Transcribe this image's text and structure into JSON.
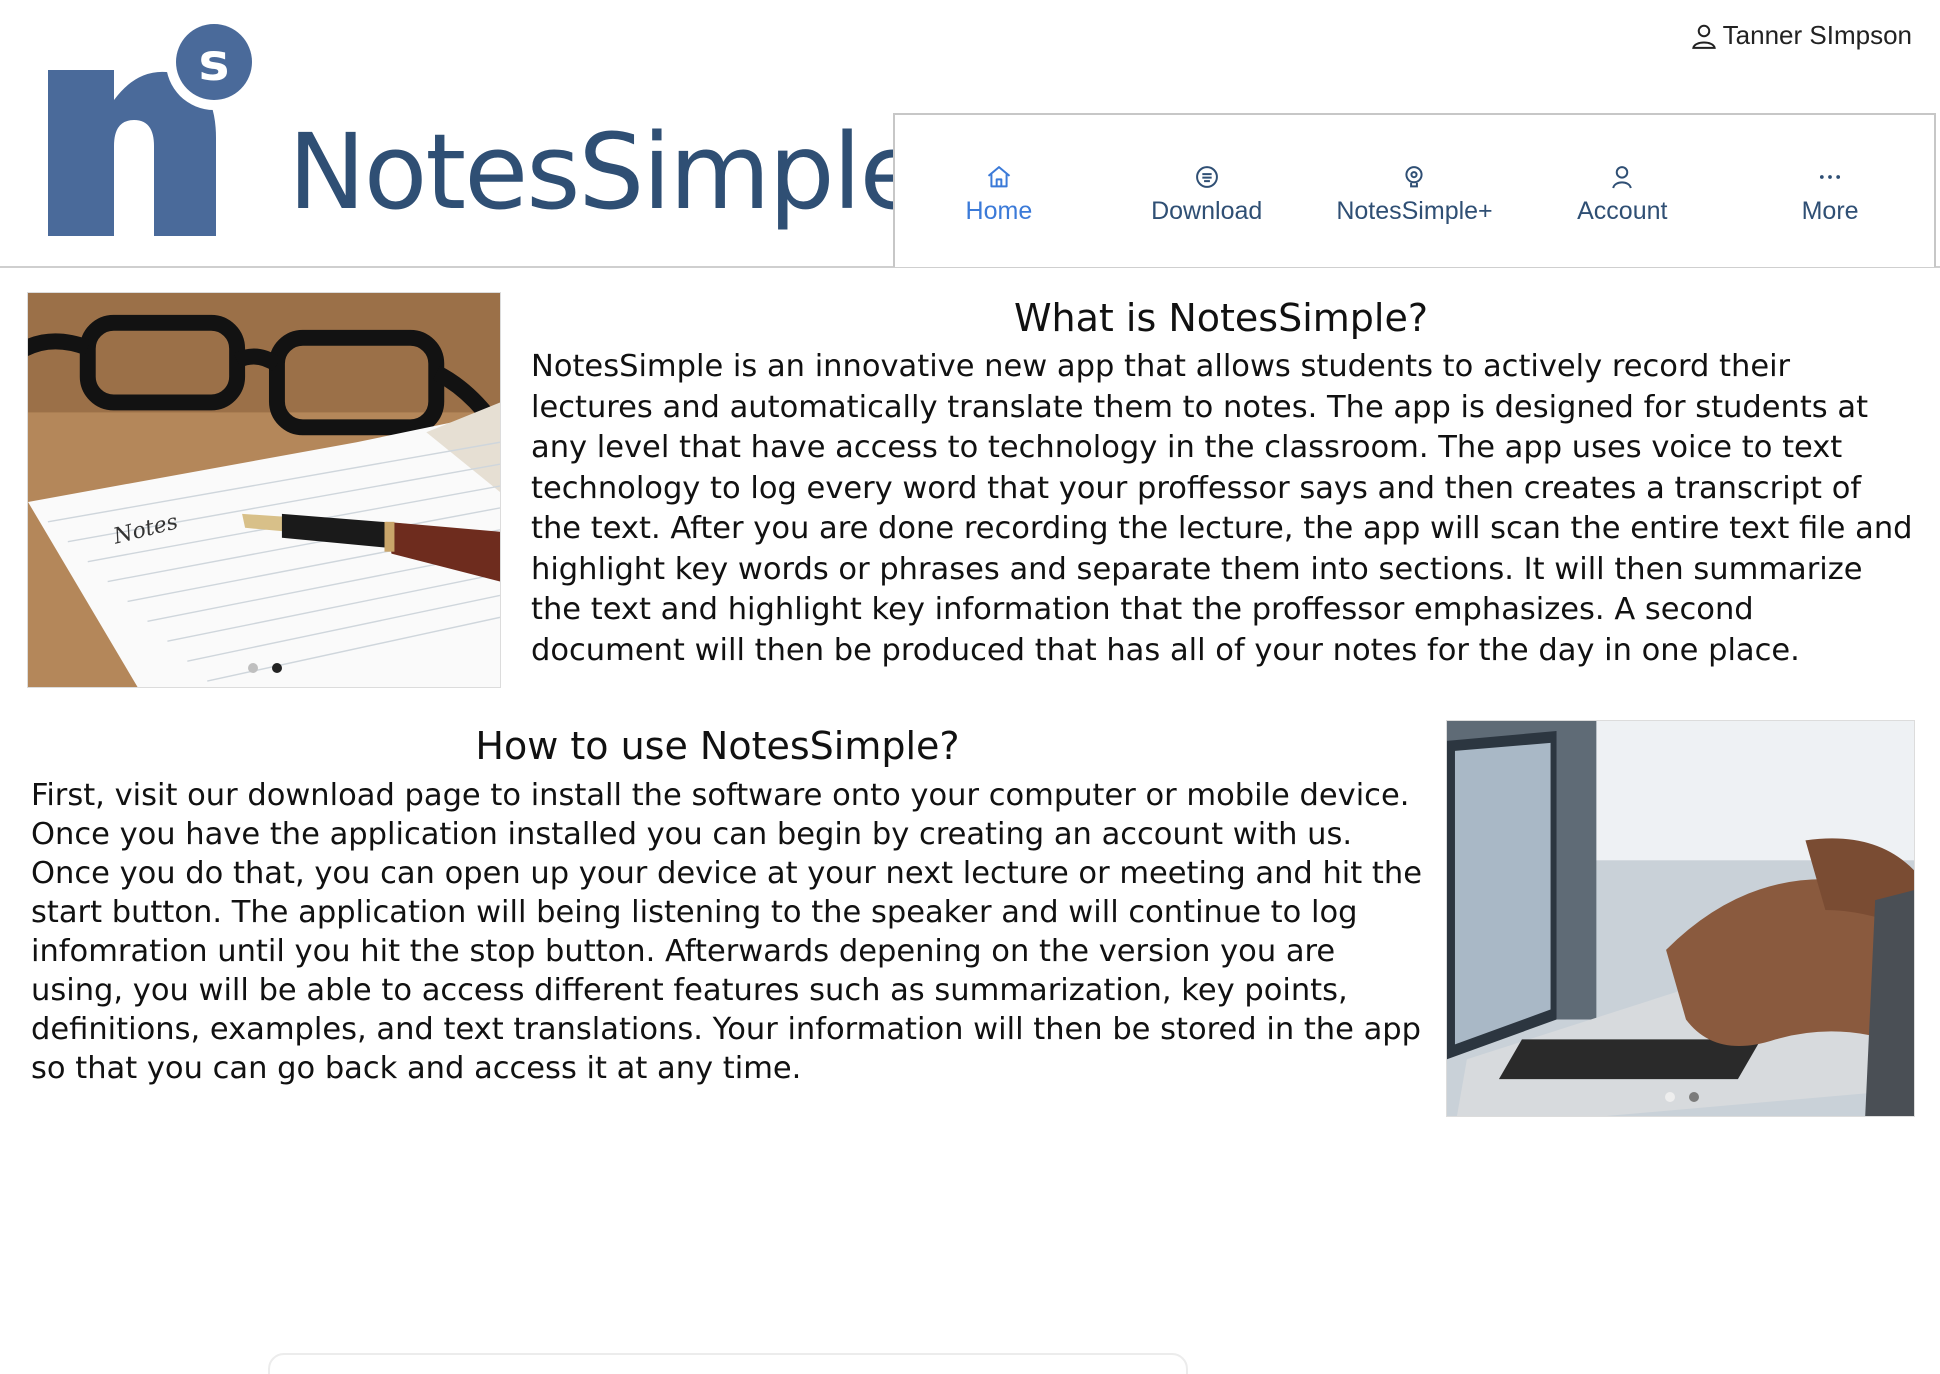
{
  "header": {
    "brand": "NotesSimple.",
    "logo_letters": {
      "main": "n",
      "badge": "s"
    },
    "user_name": "Tanner SImpson",
    "brand_color": "#2f4f74",
    "logo_color": "#4a6a9a"
  },
  "nav": {
    "items": [
      {
        "label": "Home",
        "icon": "home-icon",
        "active": true
      },
      {
        "label": "Download",
        "icon": "download-icon",
        "active": false
      },
      {
        "label": "NotesSimple+",
        "icon": "bulb-icon",
        "active": false
      },
      {
        "label": "Account",
        "icon": "person-icon",
        "active": false
      },
      {
        "label": "More",
        "icon": "ellipsis-icon",
        "active": false
      }
    ],
    "active_color": "#3b7ad8"
  },
  "section1": {
    "title": "What is NotesSimple?",
    "body": "NotesSimple is an innovative new app that allows students to actively record their lectures and automatically translate them to notes. The app is designed for students at any level that have access to technology in the classroom. The app uses voice to text technology to log every word that your proffessor says and then creates a transcript of the text. After you are done recording the lecture, the app will scan the entire text file and highlight key words or phrases and separate them into sections. It will then summarize the text and highlight key information that the proffessor emphasizes. A second document will then be produced that has all of your notes for the day in one place.",
    "image_label": "Notes",
    "carousel": {
      "count": 2,
      "active": 2
    }
  },
  "section2": {
    "title": "How to use NotesSimple?",
    "body": "First, visit our download page to install the software onto your computer or mobile device. Once you have the application installed you can begin by creating an account with us. Once you do that, you can open up your device at your next lecture or meeting and hit the start button. The application will being listening to the speaker and will continue to log infomration until you hit the stop button. Afterwards depening on the version you are using, you will be able to access different features such as summarization, key points, definitions, examples, and text translations. Your information will then be stored in the app so that you can go back and access it at any time.",
    "carousel": {
      "count": 2,
      "active": 1
    }
  }
}
